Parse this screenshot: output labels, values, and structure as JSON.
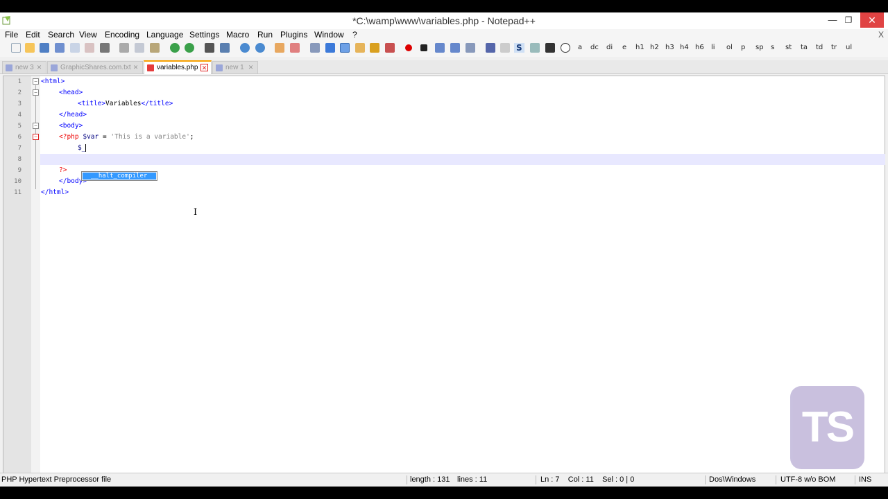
{
  "window": {
    "title": "*C:\\wamp\\www\\variables.php - Notepad++",
    "min": "—",
    "max": "❐",
    "close": "✕",
    "doc_close": "X"
  },
  "menu": [
    "File",
    "Edit",
    "Search",
    "View",
    "Encoding",
    "Language",
    "Settings",
    "Macro",
    "Run",
    "Plugins",
    "Window",
    "?"
  ],
  "toolbar_text_buttons": [
    "a",
    "dc",
    "di",
    "e",
    "h1",
    "h2",
    "h3",
    "h4",
    "h6",
    "li",
    "ol",
    "p",
    "sp",
    "s",
    "st",
    "ta",
    "td",
    "tr",
    "ul"
  ],
  "toolbar_s": "S",
  "tabs": [
    {
      "label": "new 3",
      "active": false
    },
    {
      "label": "GraphicShares.com.txt",
      "active": false
    },
    {
      "label": "variables.php",
      "active": true
    },
    {
      "label": "new 1",
      "active": false
    }
  ],
  "tab_close": "✕",
  "fold_minus": "−",
  "editor": {
    "line_numbers": [
      "1",
      "2",
      "3",
      "4",
      "5",
      "6",
      "7",
      "8",
      "9",
      "10",
      "11"
    ],
    "lines": {
      "l1": "<html>",
      "l2": "<head>",
      "l3_open": "<title>",
      "l3_text": "Variables",
      "l3_close": "</title>",
      "l4": "</head>",
      "l5": "<body>",
      "l6_kw": "<?php",
      "l6_var": "$var",
      "l6_op": " = ",
      "l6_str": "'This is a variable'",
      "l6_end": ";",
      "l7": "$_",
      "l9": "?>",
      "l10": "</body>",
      "l11": "</html>"
    },
    "autocomplete": "__halt_compiler",
    "cursor": "I"
  },
  "watermark": "TS",
  "status": {
    "file_type": "PHP Hypertext Preprocessor file",
    "length": "length : 131",
    "lines": "lines : 11",
    "position": "Ln : 7    Col : 11    Sel : 0 | 0",
    "eol": "Dos\\Windows",
    "encoding": "UTF-8 w/o BOM",
    "mode": "INS"
  },
  "colors": {
    "tag": "#0000ff",
    "close_button": "#e04343",
    "active_tab_accent": "#f7a000",
    "selection": "#3399ff"
  }
}
